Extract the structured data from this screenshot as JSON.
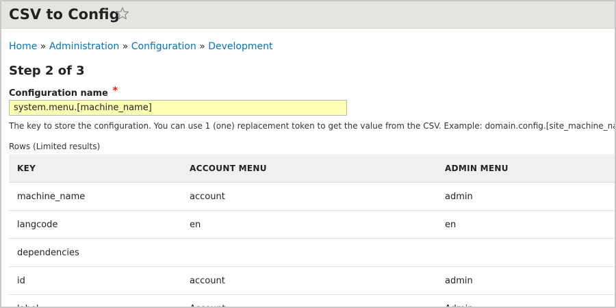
{
  "header": {
    "title": "CSV to Config",
    "favorite_icon": "star-outline-icon"
  },
  "breadcrumb": {
    "items": [
      "Home",
      "Administration",
      "Configuration",
      "Development"
    ],
    "separator": "»"
  },
  "form": {
    "step_title": "Step 2 of 3",
    "config_name_label": "Configuration name",
    "required_marker": "*",
    "config_name_value": "system.menu.[machine_name]",
    "config_name_description": "The key to store the configuration. You can use 1 (one) replacement token to get the value from the CSV. Example: domain.config.[site_machine_name]",
    "rows_caption": "Rows (Limited results)"
  },
  "table": {
    "headers": [
      "KEY",
      "ACCOUNT MENU",
      "ADMIN MENU"
    ],
    "rows": [
      [
        "machine_name",
        "account",
        "admin"
      ],
      [
        "langcode",
        "en",
        "en"
      ],
      [
        "dependencies",
        "",
        ""
      ],
      [
        "id",
        "account",
        "admin"
      ],
      [
        "label",
        "Account",
        "Admin"
      ]
    ]
  },
  "colors": {
    "link": "#0074bd",
    "required": "#e32700",
    "input_highlight": "#ffffb4",
    "header_bg": "#e4e4e0"
  }
}
